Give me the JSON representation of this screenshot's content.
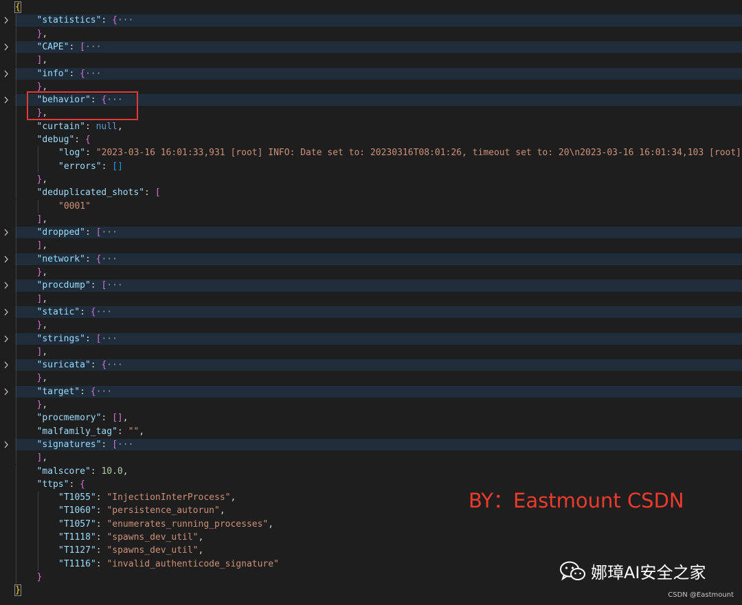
{
  "lines": [
    {
      "collapsed": false,
      "indent": 0,
      "tokens": [
        {
          "t": "{",
          "c": "b1 firstbrace"
        }
      ]
    },
    {
      "collapsed": true,
      "indent": 1,
      "tokens": [
        {
          "t": "\"statistics\"",
          "c": "k"
        },
        {
          "t": ": ",
          "c": "w"
        },
        {
          "t": "{",
          "c": "b2"
        },
        {
          "t": "···",
          "c": "ell"
        }
      ]
    },
    {
      "collapsed": false,
      "indent": 1,
      "tokens": [
        {
          "t": "}",
          "c": "b2"
        },
        {
          "t": ",",
          "c": "w"
        }
      ]
    },
    {
      "collapsed": true,
      "indent": 1,
      "tokens": [
        {
          "t": "\"CAPE\"",
          "c": "k"
        },
        {
          "t": ": ",
          "c": "w"
        },
        {
          "t": "[",
          "c": "b2"
        },
        {
          "t": "···",
          "c": "ell"
        }
      ]
    },
    {
      "collapsed": false,
      "indent": 1,
      "tokens": [
        {
          "t": "]",
          "c": "b2"
        },
        {
          "t": ",",
          "c": "w"
        }
      ]
    },
    {
      "collapsed": true,
      "indent": 1,
      "tokens": [
        {
          "t": "\"info\"",
          "c": "k"
        },
        {
          "t": ": ",
          "c": "w"
        },
        {
          "t": "{",
          "c": "b2"
        },
        {
          "t": "···",
          "c": "ell"
        }
      ]
    },
    {
      "collapsed": false,
      "indent": 1,
      "tokens": [
        {
          "t": "}",
          "c": "b2"
        },
        {
          "t": ",",
          "c": "w"
        }
      ]
    },
    {
      "collapsed": true,
      "indent": 1,
      "tokens": [
        {
          "t": "\"behavior\"",
          "c": "k"
        },
        {
          "t": ": ",
          "c": "w"
        },
        {
          "t": "{",
          "c": "b2"
        },
        {
          "t": "···",
          "c": "ell"
        }
      ]
    },
    {
      "collapsed": false,
      "indent": 1,
      "tokens": [
        {
          "t": "}",
          "c": "b2"
        },
        {
          "t": ",",
          "c": "w"
        }
      ]
    },
    {
      "collapsed": false,
      "indent": 1,
      "tokens": [
        {
          "t": "\"curtain\"",
          "c": "k"
        },
        {
          "t": ": ",
          "c": "w"
        },
        {
          "t": "null",
          "c": "c"
        },
        {
          "t": ",",
          "c": "w"
        }
      ]
    },
    {
      "collapsed": false,
      "indent": 1,
      "tokens": [
        {
          "t": "\"debug\"",
          "c": "k"
        },
        {
          "t": ": ",
          "c": "w"
        },
        {
          "t": "{",
          "c": "b2"
        }
      ]
    },
    {
      "collapsed": false,
      "indent": 2,
      "tokens": [
        {
          "t": "\"log\"",
          "c": "k"
        },
        {
          "t": ": ",
          "c": "w"
        },
        {
          "t": "\"2023-03-16 16:01:33,931 [root] INFO: Date set to: 20230316T08:01:26, timeout set to: 20\\n2023-03-16 16:01:34,103 [root]",
          "c": "s"
        }
      ]
    },
    {
      "collapsed": false,
      "indent": 2,
      "tokens": [
        {
          "t": "\"errors\"",
          "c": "k"
        },
        {
          "t": ": ",
          "c": "w"
        },
        {
          "t": "[]",
          "c": "b3"
        }
      ]
    },
    {
      "collapsed": false,
      "indent": 1,
      "tokens": [
        {
          "t": "}",
          "c": "b2"
        },
        {
          "t": ",",
          "c": "w"
        }
      ]
    },
    {
      "collapsed": false,
      "indent": 1,
      "tokens": [
        {
          "t": "\"deduplicated_shots\"",
          "c": "k"
        },
        {
          "t": ": ",
          "c": "w"
        },
        {
          "t": "[",
          "c": "b2"
        }
      ]
    },
    {
      "collapsed": false,
      "indent": 2,
      "tokens": [
        {
          "t": "\"0001\"",
          "c": "s"
        }
      ]
    },
    {
      "collapsed": false,
      "indent": 1,
      "tokens": [
        {
          "t": "]",
          "c": "b2"
        },
        {
          "t": ",",
          "c": "w"
        }
      ]
    },
    {
      "collapsed": true,
      "indent": 1,
      "tokens": [
        {
          "t": "\"dropped\"",
          "c": "k"
        },
        {
          "t": ": ",
          "c": "w"
        },
        {
          "t": "[",
          "c": "b2"
        },
        {
          "t": "···",
          "c": "ell"
        }
      ]
    },
    {
      "collapsed": false,
      "indent": 1,
      "tokens": [
        {
          "t": "]",
          "c": "b2"
        },
        {
          "t": ",",
          "c": "w"
        }
      ]
    },
    {
      "collapsed": true,
      "indent": 1,
      "tokens": [
        {
          "t": "\"network\"",
          "c": "k"
        },
        {
          "t": ": ",
          "c": "w"
        },
        {
          "t": "{",
          "c": "b2"
        },
        {
          "t": "···",
          "c": "ell"
        }
      ]
    },
    {
      "collapsed": false,
      "indent": 1,
      "tokens": [
        {
          "t": "}",
          "c": "b2"
        },
        {
          "t": ",",
          "c": "w"
        }
      ]
    },
    {
      "collapsed": true,
      "indent": 1,
      "tokens": [
        {
          "t": "\"procdump\"",
          "c": "k"
        },
        {
          "t": ": ",
          "c": "w"
        },
        {
          "t": "[",
          "c": "b2"
        },
        {
          "t": "···",
          "c": "ell"
        }
      ]
    },
    {
      "collapsed": false,
      "indent": 1,
      "tokens": [
        {
          "t": "]",
          "c": "b2"
        },
        {
          "t": ",",
          "c": "w"
        }
      ]
    },
    {
      "collapsed": true,
      "indent": 1,
      "tokens": [
        {
          "t": "\"static\"",
          "c": "k"
        },
        {
          "t": ": ",
          "c": "w"
        },
        {
          "t": "{",
          "c": "b2"
        },
        {
          "t": "···",
          "c": "ell"
        }
      ]
    },
    {
      "collapsed": false,
      "indent": 1,
      "tokens": [
        {
          "t": "}",
          "c": "b2"
        },
        {
          "t": ",",
          "c": "w"
        }
      ]
    },
    {
      "collapsed": true,
      "indent": 1,
      "tokens": [
        {
          "t": "\"strings\"",
          "c": "k"
        },
        {
          "t": ": ",
          "c": "w"
        },
        {
          "t": "[",
          "c": "b2"
        },
        {
          "t": "···",
          "c": "ell"
        }
      ]
    },
    {
      "collapsed": false,
      "indent": 1,
      "tokens": [
        {
          "t": "]",
          "c": "b2"
        },
        {
          "t": ",",
          "c": "w"
        }
      ]
    },
    {
      "collapsed": true,
      "indent": 1,
      "tokens": [
        {
          "t": "\"suricata\"",
          "c": "k"
        },
        {
          "t": ": ",
          "c": "w"
        },
        {
          "t": "{",
          "c": "b2"
        },
        {
          "t": "···",
          "c": "ell"
        }
      ]
    },
    {
      "collapsed": false,
      "indent": 1,
      "tokens": [
        {
          "t": "}",
          "c": "b2"
        },
        {
          "t": ",",
          "c": "w"
        }
      ]
    },
    {
      "collapsed": true,
      "indent": 1,
      "tokens": [
        {
          "t": "\"target\"",
          "c": "k"
        },
        {
          "t": ": ",
          "c": "w"
        },
        {
          "t": "{",
          "c": "b2"
        },
        {
          "t": "···",
          "c": "ell"
        }
      ]
    },
    {
      "collapsed": false,
      "indent": 1,
      "tokens": [
        {
          "t": "}",
          "c": "b2"
        },
        {
          "t": ",",
          "c": "w"
        }
      ]
    },
    {
      "collapsed": false,
      "indent": 1,
      "tokens": [
        {
          "t": "\"procmemory\"",
          "c": "k"
        },
        {
          "t": ": ",
          "c": "w"
        },
        {
          "t": "[]",
          "c": "b2"
        },
        {
          "t": ",",
          "c": "w"
        }
      ]
    },
    {
      "collapsed": false,
      "indent": 1,
      "tokens": [
        {
          "t": "\"malfamily_tag\"",
          "c": "k"
        },
        {
          "t": ": ",
          "c": "w"
        },
        {
          "t": "\"\"",
          "c": "s"
        },
        {
          "t": ",",
          "c": "w"
        }
      ]
    },
    {
      "collapsed": true,
      "indent": 1,
      "tokens": [
        {
          "t": "\"signatures\"",
          "c": "k"
        },
        {
          "t": ": ",
          "c": "w"
        },
        {
          "t": "[",
          "c": "b2"
        },
        {
          "t": "···",
          "c": "ell"
        }
      ]
    },
    {
      "collapsed": false,
      "indent": 1,
      "tokens": [
        {
          "t": "]",
          "c": "b2"
        },
        {
          "t": ",",
          "c": "w"
        }
      ]
    },
    {
      "collapsed": false,
      "indent": 1,
      "tokens": [
        {
          "t": "\"malscore\"",
          "c": "k"
        },
        {
          "t": ": ",
          "c": "w"
        },
        {
          "t": "10.0",
          "c": "n"
        },
        {
          "t": ",",
          "c": "w"
        }
      ]
    },
    {
      "collapsed": false,
      "indent": 1,
      "tokens": [
        {
          "t": "\"ttps\"",
          "c": "k"
        },
        {
          "t": ": ",
          "c": "w"
        },
        {
          "t": "{",
          "c": "b2"
        }
      ]
    },
    {
      "collapsed": false,
      "indent": 2,
      "tokens": [
        {
          "t": "\"T1055\"",
          "c": "k"
        },
        {
          "t": ": ",
          "c": "w"
        },
        {
          "t": "\"InjectionInterProcess\"",
          "c": "s"
        },
        {
          "t": ",",
          "c": "w"
        }
      ]
    },
    {
      "collapsed": false,
      "indent": 2,
      "tokens": [
        {
          "t": "\"T1060\"",
          "c": "k"
        },
        {
          "t": ": ",
          "c": "w"
        },
        {
          "t": "\"persistence_autorun\"",
          "c": "s"
        },
        {
          "t": ",",
          "c": "w"
        }
      ]
    },
    {
      "collapsed": false,
      "indent": 2,
      "tokens": [
        {
          "t": "\"T1057\"",
          "c": "k"
        },
        {
          "t": ": ",
          "c": "w"
        },
        {
          "t": "\"enumerates_running_processes\"",
          "c": "s"
        },
        {
          "t": ",",
          "c": "w"
        }
      ]
    },
    {
      "collapsed": false,
      "indent": 2,
      "tokens": [
        {
          "t": "\"T1118\"",
          "c": "k"
        },
        {
          "t": ": ",
          "c": "w"
        },
        {
          "t": "\"spawns_dev_util\"",
          "c": "s"
        },
        {
          "t": ",",
          "c": "w"
        }
      ]
    },
    {
      "collapsed": false,
      "indent": 2,
      "tokens": [
        {
          "t": "\"T1127\"",
          "c": "k"
        },
        {
          "t": ": ",
          "c": "w"
        },
        {
          "t": "\"spawns_dev_util\"",
          "c": "s"
        },
        {
          "t": ",",
          "c": "w"
        }
      ]
    },
    {
      "collapsed": false,
      "indent": 2,
      "tokens": [
        {
          "t": "\"T1116\"",
          "c": "k"
        },
        {
          "t": ": ",
          "c": "w"
        },
        {
          "t": "\"invalid_authenticode_signature\"",
          "c": "s"
        }
      ]
    },
    {
      "collapsed": false,
      "indent": 1,
      "tokens": [
        {
          "t": "}",
          "c": "b2"
        }
      ]
    },
    {
      "collapsed": false,
      "indent": 0,
      "tokens": [
        {
          "t": "}",
          "c": "b1 firstbrace"
        }
      ]
    }
  ],
  "fold_icon": "chevron-right-icon",
  "watermark": {
    "text": "BY：Eastmount CSDN",
    "color": "#ef3b2c"
  },
  "wechat": {
    "icon": "wechat-icon",
    "label": "娜璋AI安全之家"
  },
  "credit": "CSDN @Eastmount",
  "colors": {
    "background": "#1e1e1e",
    "key": "#9cdcfe",
    "string": "#ce9178",
    "number": "#b5cea8",
    "keyword": "#569cd6",
    "highlight_box": "#e53935"
  }
}
